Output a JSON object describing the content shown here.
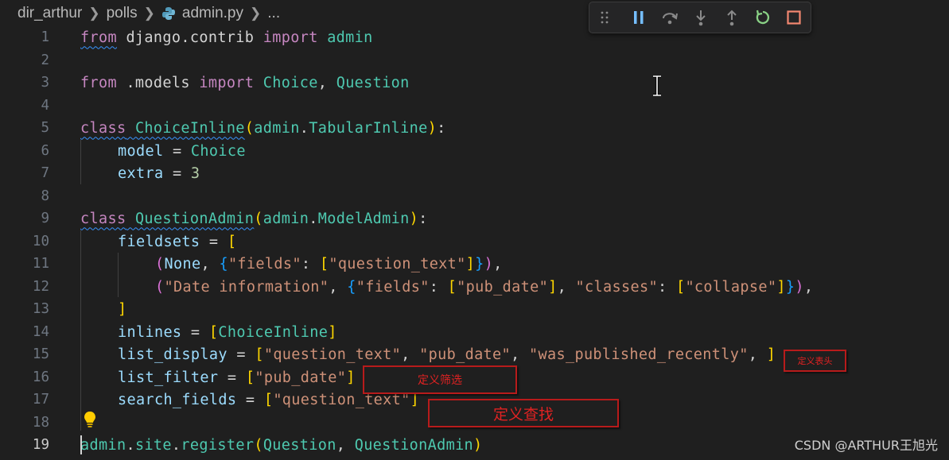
{
  "breadcrumb": {
    "folder": "dir_arthur",
    "subfolder": "polls",
    "file": "admin.py",
    "more": "...",
    "file_icon": "python-icon"
  },
  "debug_toolbar": {
    "buttons": [
      "gripper-icon",
      "pause-icon",
      "step-over-icon",
      "step-into-icon",
      "step-out-icon",
      "restart-icon",
      "stop-icon"
    ],
    "colors": {
      "pause": "#75beff",
      "restart": "#89d185",
      "stop": "#f48771"
    }
  },
  "editor": {
    "active_line": 19,
    "lines": [
      {
        "num": "1"
      },
      {
        "num": "2"
      },
      {
        "num": "3"
      },
      {
        "num": "4"
      },
      {
        "num": "5"
      },
      {
        "num": "6"
      },
      {
        "num": "7"
      },
      {
        "num": "8"
      },
      {
        "num": "9"
      },
      {
        "num": "10"
      },
      {
        "num": "11"
      },
      {
        "num": "12"
      },
      {
        "num": "13"
      },
      {
        "num": "14"
      },
      {
        "num": "15"
      },
      {
        "num": "16"
      },
      {
        "num": "17"
      },
      {
        "num": "18"
      },
      {
        "num": "19"
      }
    ],
    "tokens": {
      "l1_from": "from",
      "l1_mod": " django.contrib ",
      "l1_import": "import",
      "l1_name": " admin",
      "l3_from": "from",
      "l3_mod": " .models ",
      "l3_import": "import",
      "l3_c1": " Choice",
      "l3_comma": ",",
      "l3_c2": " Question",
      "l5_class": "class",
      "l5_name": " ChoiceInline",
      "l5_open": "(",
      "l5_base1": "admin",
      "l5_dot": ".",
      "l5_base2": "TabularInline",
      "l5_close": ")",
      "l5_colon": ":",
      "l6_var": "model",
      "l6_eq": " = ",
      "l6_val": "Choice",
      "l7_var": "extra",
      "l7_eq": " = ",
      "l7_val": "3",
      "l9_class": "class",
      "l9_name": " QuestionAdmin",
      "l9_open": "(",
      "l9_base1": "admin",
      "l9_dot": ".",
      "l9_base2": "ModelAdmin",
      "l9_close": ")",
      "l9_colon": ":",
      "l10_var": "fieldsets",
      "l10_eq": " = ",
      "l10_open": "[",
      "l11_p": "(",
      "l11_none": "None",
      "l11_c": ", ",
      "l11_b": "{",
      "l11_key": "\"fields\"",
      "l11_col": ": ",
      "l11_lb": "[",
      "l11_val": "\"question_text\"",
      "l11_rb": "]",
      "l11_eb": "}",
      "l11_ep": ")",
      "l11_end": ",",
      "l12_p": "(",
      "l12_s": "\"Date information\"",
      "l12_c": ", ",
      "l12_b": "{",
      "l12_key": "\"fields\"",
      "l12_col": ": ",
      "l12_lb": "[",
      "l12_val": "\"pub_date\"",
      "l12_rb": "]",
      "l12_c2": ", ",
      "l12_key2": "\"classes\"",
      "l12_col2": ": ",
      "l12_lb2": "[",
      "l12_val2": "\"collapse\"",
      "l12_rb2": "]",
      "l12_eb": "}",
      "l12_ep": ")",
      "l12_end": ",",
      "l13_close": "]",
      "l14_var": "inlines",
      "l14_eq": " = ",
      "l14_lb": "[",
      "l14_val": "ChoiceInline",
      "l14_rb": "]",
      "l15_var": "list_display",
      "l15_eq": " = ",
      "l15_lb": "[",
      "l15_s1": "\"question_text\"",
      "l15_c1": ", ",
      "l15_s2": "\"pub_date\"",
      "l15_c2": ", ",
      "l15_s3": "\"was_published_recently\"",
      "l15_c3": ", ",
      "l15_rb": "]",
      "l16_var": "list_filter",
      "l16_eq": " = ",
      "l16_lb": "[",
      "l16_s": "\"pub_date\"",
      "l16_rb": "]",
      "l17_var": "search_fields",
      "l17_eq": " = ",
      "l17_lb": "[",
      "l17_s": "\"question_text\"",
      "l17_rb": "]",
      "l19_a": "admin",
      "l19_d1": ".",
      "l19_b": "site",
      "l19_d2": ".",
      "l19_c": "register",
      "l19_p": "(",
      "l19_q": "Question",
      "l19_cm": ", ",
      "l19_qa": "QuestionAdmin",
      "l19_ep": ")"
    }
  },
  "annotations": {
    "display_note": "定义表头",
    "filter_note": "定义筛选",
    "search_note": "定义查找"
  },
  "watermark": "CSDN @ARTHUR王旭光"
}
